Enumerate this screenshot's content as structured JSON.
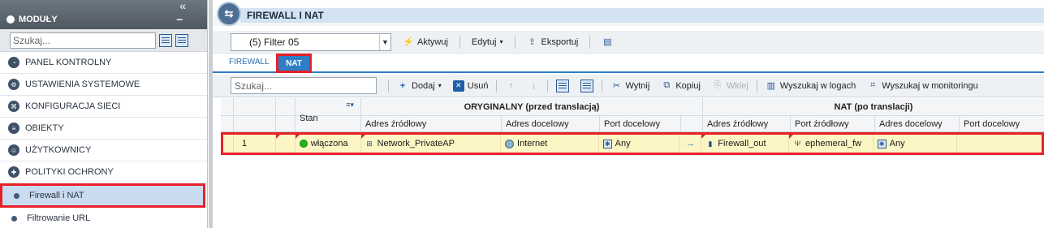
{
  "sidebar": {
    "title": "MODUŁY",
    "collapse_icon": "«",
    "minimize_icon": "–",
    "search_placeholder": "Szukaj...",
    "items": [
      {
        "label": "PANEL KONTROLNY",
        "icon": "dashboard-icon"
      },
      {
        "label": "USTAWIENIA SYSTEMOWE",
        "icon": "settings-icon"
      },
      {
        "label": "KONFIGURACJA SIECI",
        "icon": "network-icon"
      },
      {
        "label": "OBIEKTY",
        "icon": "database-icon"
      },
      {
        "label": "UŻYTKOWNICY",
        "icon": "user-icon"
      },
      {
        "label": "POLITYKI OCHRONY",
        "icon": "policy-icon"
      }
    ],
    "sub_items": [
      {
        "label": "Firewall i NAT",
        "active": true
      },
      {
        "label": "Filtrowanie URL",
        "active": false
      }
    ]
  },
  "main": {
    "title": "FIREWALL I NAT",
    "filter": {
      "value": "(5) Filter 05"
    },
    "toolbar1": {
      "activate": "Aktywuj",
      "edit": "Edytuj",
      "export": "Eksportuj"
    },
    "tabs": {
      "firewall": "FIREWALL",
      "nat": "NAT"
    },
    "toolbar2": {
      "search_placeholder": "Szukaj...",
      "add": "Dodaj",
      "remove": "Usuń",
      "cut": "Wytnij",
      "copy": "Kopiuj",
      "paste": "Wklej",
      "search_logs": "Wyszukaj w logach",
      "search_monitoring": "Wyszukaj w monitoringu"
    },
    "grid": {
      "group_original": "ORYGINALNY (przed translacją)",
      "group_nat": "NAT (po translacji)",
      "col_state": "Stan",
      "columns_original": [
        "Adres źródłowy",
        "Adres docelowy",
        "Port docelowy"
      ],
      "columns_nat": [
        "Adres źródłowy",
        "Port źródłowy",
        "Adres docelowy",
        "Port docelowy"
      ],
      "row": {
        "index": "1",
        "state": "włączona",
        "orig_src": "Network_PrivateAP",
        "orig_dst": "Internet",
        "orig_port": "Any",
        "arrow": "→",
        "nat_src": "Firewall_out",
        "nat_src_port": "ephemeral_fw",
        "nat_dst": "Any",
        "nat_dst_port": ""
      }
    }
  },
  "colors": {
    "highlight_border": "#e8202a",
    "accent_blue": "#2f7dc4",
    "row_highlight": "#fbf6c3",
    "status_green": "#23b21d"
  }
}
